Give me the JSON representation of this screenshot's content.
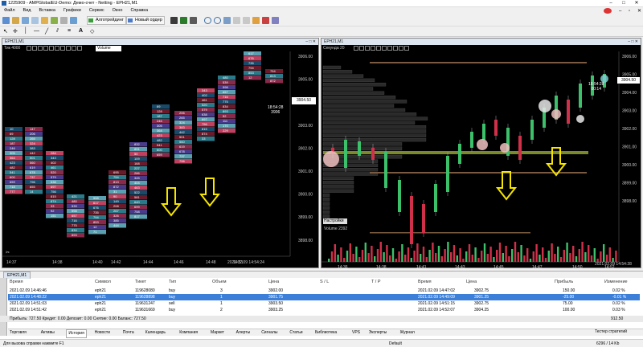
{
  "window": {
    "title": "1225909 - AMPGlobalEU-Demo: Демо-счет - Netting - EPH21,M1"
  },
  "menu": [
    "Файл",
    "Вид",
    "Вставка",
    "Графики",
    "Сервис",
    "Окно",
    "Справка"
  ],
  "toolbar": {
    "algo_label": "Алготрейдинг",
    "new_order_label": "Новый ордер"
  },
  "left_chart": {
    "tab_label": "EPH21,M1",
    "sub_label": "Тик 4000",
    "volume_select": "Volume",
    "price_labels": [
      "3906.00",
      "3905.00",
      "3904.00",
      "3903.00",
      "3902.00",
      "3901.00",
      "3900.00",
      "3899.00",
      "3898.00"
    ],
    "current_price": "3904.50",
    "cursor_time": "18:54:28",
    "cursor_value": "3906",
    "time_labels": [
      "14:37",
      "14:38",
      "14:40",
      "14:42",
      "14:44",
      "14:46",
      "14:48",
      "14:51"
    ],
    "date_label": "2021.02.09 14:54:24"
  },
  "right_chart": {
    "tab_label": "EPH21,M1",
    "sub_label": "Секунда 20",
    "price_labels": [
      "3906.00",
      "3905.00",
      "3904.00",
      "3903.00",
      "3902.00",
      "3901.00",
      "3900.00",
      "3899.00",
      "3898.00"
    ],
    "current_price": "3904.50",
    "timer_label": "18:54:28",
    "timer_sub": "00:14",
    "settings_label": "Настройки",
    "volume_label": "Volume 2392",
    "time_labels": [
      "14:36",
      "14:38",
      "14:41",
      "14:43",
      "14:45",
      "14:47",
      "14:50",
      "14:52"
    ],
    "date_label": "2021.02.09 14:54:28"
  },
  "bottom_tab": "EPH21,M1",
  "trade_table": {
    "headers": [
      "Время",
      "Символ",
      "Тикет",
      "Тип",
      "Объем",
      "Цена",
      "S / L",
      "T / P",
      "Время",
      "Цена",
      "Прибыль",
      "Изменение"
    ],
    "rows": [
      {
        "time": "2021.02.09 14:46:46",
        "symbol": "eph21",
        "ticket": "119628080",
        "type": "buy",
        "volume": "3",
        "price": "3902.00",
        "close_time": "2021.02.09 14:47:02",
        "close_price": "3902.75",
        "profit": "150.00",
        "change": "0.02 %"
      },
      {
        "time": "2021.02.09 14:48:22",
        "symbol": "eph21",
        "ticket": "119628898",
        "type": "buy",
        "volume": "1",
        "price": "3901.75",
        "close_time": "2021.02.09 14:49:09",
        "close_price": "3901.25",
        "profit": "-25.00",
        "change": "-0.01 %"
      },
      {
        "time": "2021.02.09 14:51:03",
        "symbol": "eph21",
        "ticket": "119631247",
        "type": "sell",
        "volume": "1",
        "price": "3903.50",
        "close_time": "2021.02.09 14:51:15",
        "close_price": "3902.75",
        "profit": "75.00",
        "change": "0.02 %"
      },
      {
        "time": "2021.02.09 14:51:42",
        "symbol": "eph21",
        "ticket": "119631669",
        "type": "buy",
        "volume": "2",
        "price": "3903.25",
        "close_time": "2021.02.09 14:52:07",
        "close_price": "3904.25",
        "profit": "100.00",
        "change": "0.03 %"
      }
    ],
    "summary": "Прибыль: 727.50  Кредит: 0.00  Депозит: 0.00  Снятие: 0.00  Баланс: 727.50",
    "summary_total": "912.50"
  },
  "nav_tabs": [
    "Торговля",
    "Активы",
    "История",
    "Новости",
    "Почта",
    "Календарь",
    "Компания",
    "Маркет",
    "Алерты",
    "Сигналы",
    "Статьи",
    "Библиотека",
    "VPS",
    "Эксперты",
    "Журнал"
  ],
  "nav_active": "История",
  "strategy_tester": "Тестер стратегий",
  "status": {
    "help": "Для вызова справки нажмите F1",
    "profile": "Default",
    "memory": "6296 / 14 Kb"
  }
}
